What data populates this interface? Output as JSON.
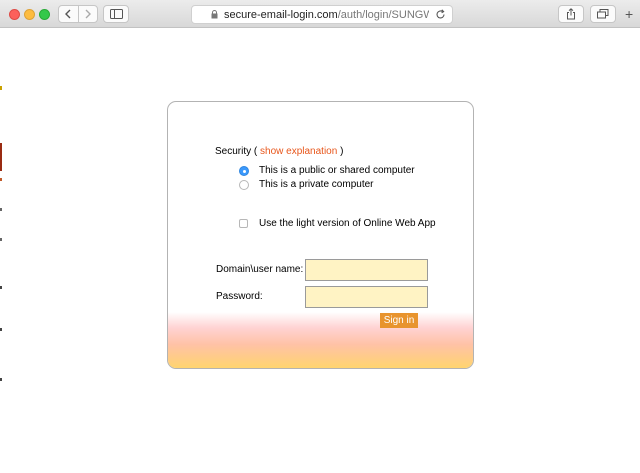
{
  "browser": {
    "url_host": "secure-email-login.com",
    "url_path": "/auth/login/SUNGWDJERY",
    "colors": {
      "close": "#fc605b",
      "minimize": "#fdbc40",
      "zoom": "#34c84a"
    },
    "icons": [
      "back-icon",
      "forward-icon",
      "sidebar-icon",
      "lock-icon",
      "reload-icon",
      "share-icon",
      "tabs-icon",
      "new-tab-icon"
    ],
    "new_tab_symbol": "+"
  },
  "login": {
    "security_label": "Security (",
    "show_explanation": "show explanation",
    "security_close": ")",
    "options": [
      {
        "label": "This is a public or shared computer",
        "selected": true
      },
      {
        "label": "This is a private computer",
        "selected": false
      }
    ],
    "light_version_label": "Use the light version of Online Web App",
    "light_version_checked": false,
    "username_label": "Domain\\user name:",
    "username_value": "",
    "password_label": "Password:",
    "password_value": "",
    "signin_label": "Sign in",
    "colors": {
      "accent": "#e8561b",
      "button": "#e8942e",
      "field": "#fff3c4",
      "radio": "#3b99fc"
    }
  }
}
